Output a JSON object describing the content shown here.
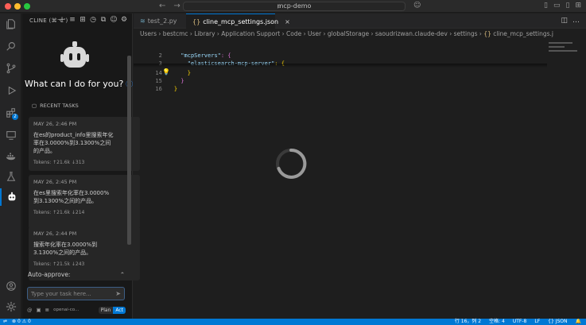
{
  "window": {
    "title": "mcp-demo"
  },
  "activity_bar": {
    "extensions_badge": "2"
  },
  "cline": {
    "panel_title": "CLINE (⌘⌥')",
    "welcome": "What can I do for you?",
    "recent_tasks_label": "RECENT TASKS",
    "tasks": [
      {
        "date": "MAY 26, 2:46 PM",
        "text": "在es的product_info里搜索年化率在3.0000%到3.1300%之间的产品。",
        "tokens": "Tokens: ↑21.6k ↓313"
      },
      {
        "date": "MAY 26, 2:45 PM",
        "text": "在es里搜索年化率在3.0000%到3.1300%之间的产品。",
        "tokens": "Tokens: ↑21.6k ↓214"
      },
      {
        "date": "MAY 26, 2:44 PM",
        "text": "搜索年化率在3.0000%到3.1300%之间的产品。",
        "tokens": "Tokens: ↑21.5k ↓243"
      }
    ],
    "auto_approve_label": "Auto-approve:",
    "input_placeholder": "Type your task here...",
    "model": "openai-co...",
    "mode_plan": "Plan",
    "mode_act": "Act"
  },
  "editor": {
    "tabs": [
      {
        "label": "test_2.py",
        "icon": "python-icon"
      },
      {
        "label": "cline_mcp_settings.json",
        "icon": "json-icon"
      }
    ],
    "breadcrumb": "Users › bestcmc › Library › Application Support › Code › User › globalStorage › saoudrizwan.claude-dev › settings › ",
    "breadcrumb_file": "cline_mcp_settings.json",
    "breadcrumb_tail": " › ...",
    "lines": [
      {
        "num": "2",
        "code_key": "\"mcpServers\"",
        "code_rest": ": {"
      },
      {
        "num": "3",
        "code_key": "\"elasticsearch-mcp-server\"",
        "code_rest": ": {"
      },
      {
        "num": "14",
        "code_key": "",
        "code_rest": "}"
      },
      {
        "num": "15",
        "code_key": "",
        "code_rest": "}"
      },
      {
        "num": "16",
        "code_key": "",
        "code_rest": "}"
      }
    ]
  },
  "status": {
    "errors": "0",
    "warnings": "0",
    "position": "行 16，列 2",
    "spaces": "空格: 4",
    "encoding": "UTF-8",
    "eol": "LF",
    "language": "JSON"
  },
  "colors": {
    "accent": "#0078d4",
    "json_key": "#9cdcfe",
    "bracket_gold": "#ffd700"
  }
}
